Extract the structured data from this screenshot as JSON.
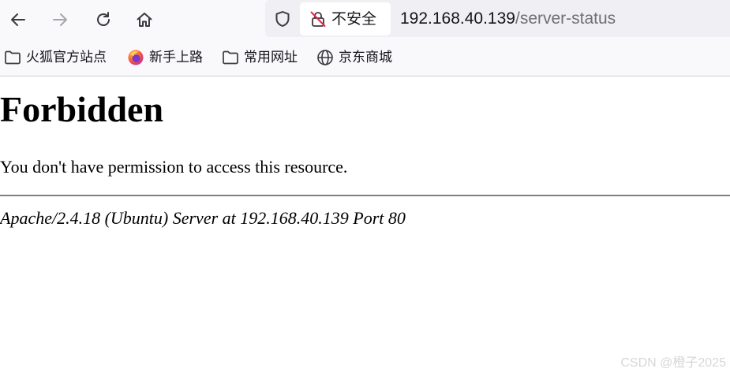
{
  "toolbar": {
    "back_icon": "arrow-left-icon",
    "forward_icon": "arrow-right-icon",
    "reload_icon": "reload-icon",
    "home_icon": "home-icon"
  },
  "urlbar": {
    "shield_icon": "shield-icon",
    "security_label": "不安全",
    "security_icon": "insecure-lock-icon",
    "url_host": "192.168.40.139",
    "url_path": "/server-status"
  },
  "bookmarks": [
    {
      "label": "火狐官方站点",
      "icon": "folder-icon"
    },
    {
      "label": "新手上路",
      "icon": "firefox-icon"
    },
    {
      "label": "常用网址",
      "icon": "folder-icon"
    },
    {
      "label": "京东商城",
      "icon": "globe-icon"
    }
  ],
  "page": {
    "title": "Forbidden",
    "message": "You don't have permission to access this resource.",
    "server_signature": "Apache/2.4.18 (Ubuntu) Server at 192.168.40.139 Port 80"
  },
  "watermark": "CSDN @橙子2025",
  "colors": {
    "toolbar_bg": "#f9f9fb",
    "urlbar_bg": "#f0f0f4",
    "insecure_red": "#e22850",
    "url_path_gray": "#6f6f74",
    "divider": "#808080",
    "watermark": "#d7d7d7"
  }
}
